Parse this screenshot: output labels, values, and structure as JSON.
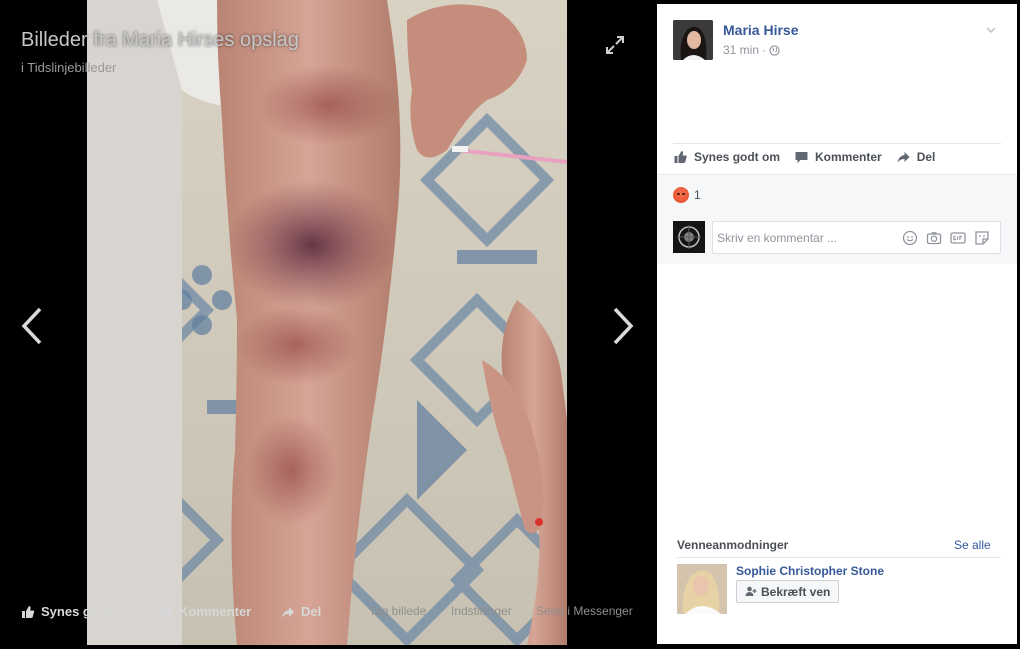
{
  "viewer": {
    "title": "Billeder fra Maria Hirses opslag",
    "subtitle": "i Tidslinjebilleder",
    "actions": {
      "like": "Synes godt om",
      "comment": "Kommenter",
      "share": "Del",
      "tag": "Tag billede",
      "options": "Indstillinger",
      "send": "Send i Messenger"
    },
    "icons": {
      "expand": "expand-icon",
      "prev": "chevron-left-icon",
      "next": "chevron-right-icon"
    }
  },
  "post": {
    "author": "Maria Hirse",
    "time": "31 min",
    "separator": "·",
    "privacy_icon": "globe-icon",
    "actions": {
      "like": "Synes godt om",
      "comment": "Kommenter",
      "share": "Del"
    },
    "reaction_icon": "angry-reaction-icon",
    "reaction_count": "1",
    "comment_placeholder": "Skriv en kommentar ..."
  },
  "friend_requests": {
    "title": "Venneanmodninger",
    "see_all": "Se alle",
    "items": [
      {
        "name": "Sophie Christopher Stone",
        "confirm_label": "Bekræft ven"
      }
    ]
  },
  "colors": {
    "link": "#365899",
    "panel_bg": "#ffffff",
    "feedback_bg": "#f6f7f9",
    "viewer_bg": "#000000"
  }
}
